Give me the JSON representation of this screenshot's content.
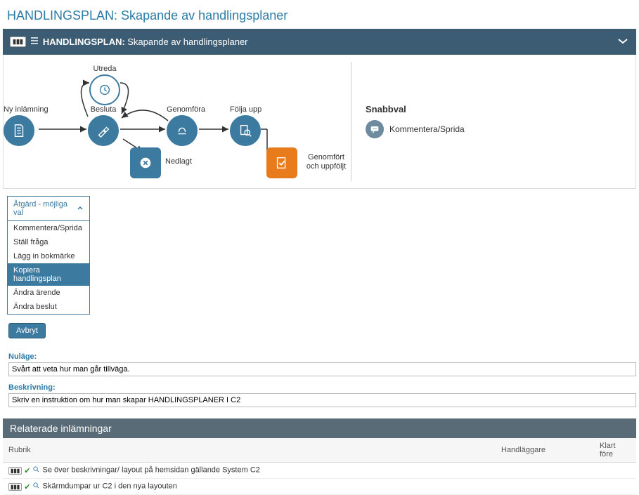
{
  "page": {
    "title_prefix": "HANDLINGSPLAN:",
    "title_rest": " Skapande av handlingsplaner"
  },
  "panel": {
    "badge": "▮▮▮",
    "title_prefix": "HANDLINGSPLAN:",
    "title_rest": " Skapande av handlingsplaner"
  },
  "workflow": {
    "nodes": {
      "ny": "Ny inlämning",
      "utreda": "Utreda",
      "besluta": "Besluta",
      "genomfora": "Genomföra",
      "folja": "Följa upp",
      "nedlagt": "Nedlagt",
      "genomfort": "Genomfört och uppföljt"
    }
  },
  "quick": {
    "title": "Snabbval",
    "item1": "Kommentera/Sprida"
  },
  "actions": {
    "header": "Åtgärd - möjliga val",
    "items": {
      "a1": "Kommentera/Sprida",
      "a2": "Ställ fråga",
      "a3": "Lägg in bokmärke",
      "a4": "Kopiera handlingsplan",
      "a5": "Ändra ärende",
      "a6": "Ändra beslut"
    }
  },
  "buttons": {
    "cancel": "Avbryt"
  },
  "fields": {
    "nulage_label": "Nuläge:",
    "nulage_value": "Svårt att veta hur man går tillväga.",
    "beskrivning_label": "Beskrivning:",
    "beskrivning_value": "Skriv en instruktion om hur man skapar HANDLINGSPLANER I C2"
  },
  "related": {
    "title": "Relaterade inlämningar",
    "cols": {
      "rubrik": "Rubrik",
      "handlaggare": "Handläggare",
      "klart": "Klart före"
    },
    "rows": [
      {
        "rubrik": "Se över beskrivningar/ layout på hemsidan gällande System C2",
        "handlaggare": "",
        "klart": ""
      },
      {
        "rubrik": "Skärmdumpar ur C2 i den nya layouten",
        "handlaggare": "",
        "klart": ""
      }
    ]
  }
}
